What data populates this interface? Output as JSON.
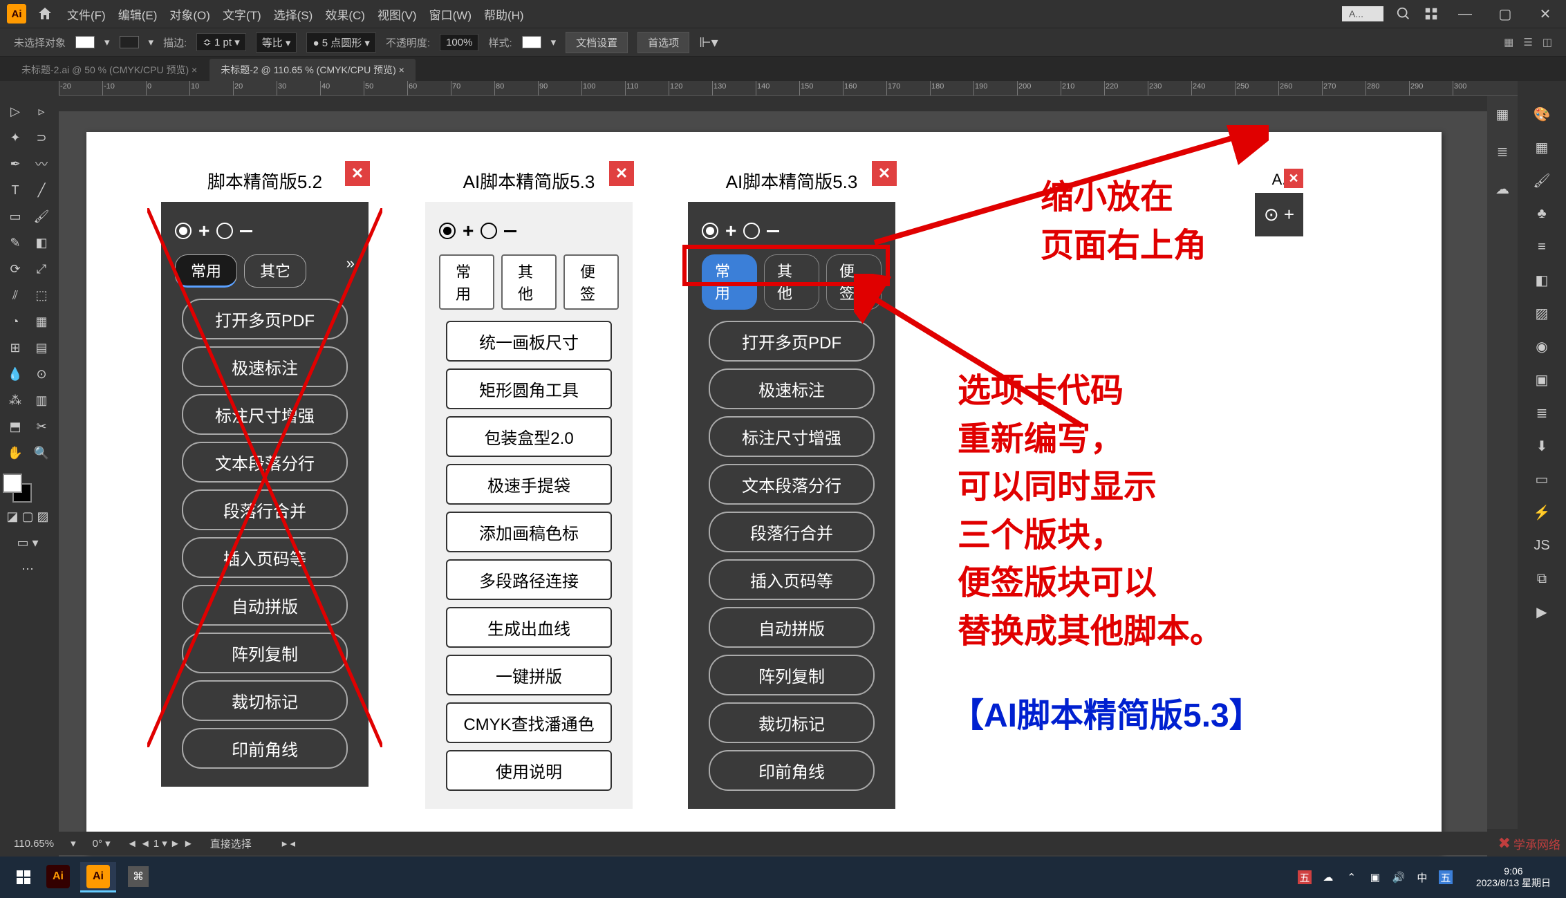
{
  "app": {
    "logo_text": "Ai",
    "topbar_input": "A..."
  },
  "menus": [
    "文件(F)",
    "编辑(E)",
    "对象(O)",
    "文字(T)",
    "选择(S)",
    "效果(C)",
    "视图(V)",
    "窗口(W)",
    "帮助(H)"
  ],
  "optionbar": {
    "noselect": "未选择对象",
    "stroke_label": "描边:",
    "stroke_val": "1 pt",
    "uniform": "等比",
    "points_val": "5 点圆形",
    "opacity_label": "不透明度:",
    "opacity_val": "100%",
    "style_label": "样式:",
    "docset": "文档设置",
    "prefs": "首选项"
  },
  "tabs": [
    "未标题-2.ai @ 50 % (CMYK/CPU 预览)",
    "未标题-2 @ 110.65 % (CMYK/CPU 预览)"
  ],
  "ruler": {
    "start": -20,
    "end": 300,
    "step": 10
  },
  "panel52": {
    "title": "脚本精简版5.2",
    "tabs": [
      "常用",
      "其它"
    ],
    "buttons": [
      "打开多页PDF",
      "极速标注",
      "标注尺寸增强",
      "文本段落分行",
      "段落行合并",
      "插入页码等",
      "自动拼版",
      "阵列复制",
      "裁切标记",
      "印前角线"
    ]
  },
  "panel53_light": {
    "title": "AI脚本精简版5.3",
    "tabs": [
      "常用",
      "其他",
      "便签"
    ],
    "buttons": [
      "统一画板尺寸",
      "矩形圆角工具",
      "包装盒型2.0",
      "极速手提袋",
      "添加画稿色标",
      "多段路径连接",
      "生成出血线",
      "一键拼版",
      "CMYK查找潘通色",
      "使用说明"
    ]
  },
  "panel53_dark": {
    "title": "AI脚本精简版5.3",
    "tabs": [
      "常用",
      "其他",
      "便签"
    ],
    "buttons": [
      "打开多页PDF",
      "极速标注",
      "标注尺寸增强",
      "文本段落分行",
      "段落行合并",
      "插入页码等",
      "自动拼版",
      "阵列复制",
      "裁切标记",
      "印前角线"
    ]
  },
  "mini": {
    "title": "A.",
    "plus": "⊙ +"
  },
  "anno": {
    "top1": "缩小放在",
    "top2": "页面右上角",
    "mid": "选项卡代码\n重新编写，\n可以同时显示\n三个版块，\n便签版块可以\n替换成其他脚本。",
    "bottom": "【AI脚本精简版5.3】"
  },
  "status": {
    "zoom": "110.65%",
    "tool": "直接选择"
  },
  "taskbar": {
    "tray_icons": [
      "五",
      "☁",
      "⌃",
      "▣",
      "🔊",
      "中",
      "五"
    ],
    "time": "9:06",
    "date": "2023/8/13 星期日"
  },
  "watermark": "学承网络"
}
